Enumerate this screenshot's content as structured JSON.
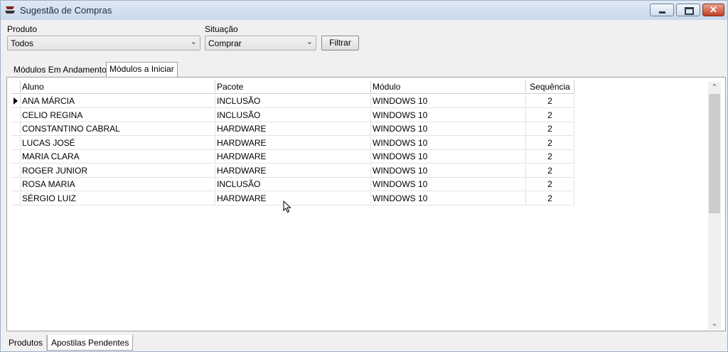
{
  "window": {
    "title": "Sugestão de Compras"
  },
  "filters": {
    "produto_label": "Produto",
    "produto_value": "Todos",
    "situacao_label": "Situação",
    "situacao_value": "Comprar",
    "filtrar_label": "Filtrar"
  },
  "tabs": [
    "Módulos Em Andamento",
    "Módulos a Iniciar"
  ],
  "grid": {
    "columns": [
      "Aluno",
      "Pacote",
      "Módulo",
      "Sequência"
    ],
    "rows": [
      [
        "ANA MÁRCIA",
        "INCLUSÃO",
        "WINDOWS 10",
        "2"
      ],
      [
        "CELIO REGINA",
        "INCLUSÃO",
        "WINDOWS 10",
        "2"
      ],
      [
        "CONSTANTINO CABRAL",
        "HARDWARE",
        "WINDOWS 10",
        "2"
      ],
      [
        "LUCAS JOSÉ",
        "HARDWARE",
        "WINDOWS 10",
        "2"
      ],
      [
        "MARIA CLARA",
        "HARDWARE",
        "WINDOWS 10",
        "2"
      ],
      [
        "ROGER JUNIOR",
        "HARDWARE",
        "WINDOWS 10",
        "2"
      ],
      [
        "ROSA MARIA",
        "INCLUSÃO",
        "WINDOWS 10",
        "2"
      ],
      [
        "SÉRGIO LUIZ",
        "HARDWARE",
        "WINDOWS 10",
        "2"
      ]
    ]
  },
  "bottom_tabs": [
    "Produtos",
    "Apostilas Pendentes"
  ],
  "icons": {
    "app": "app-icon",
    "minimize": "minimize-icon",
    "maximize": "maximize-icon",
    "close": "close-icon",
    "dropdown": "chevron-down-icon",
    "row_indicator": "row-pointer-icon",
    "scroll_up": "chevron-up-icon",
    "scroll_down": "chevron-down-icon",
    "cursor": "mouse-pointer-icon"
  },
  "colors": {
    "titlebar": "#c8d8ec",
    "close_button": "#c23f25",
    "window_bg": "#f0f0f0"
  }
}
